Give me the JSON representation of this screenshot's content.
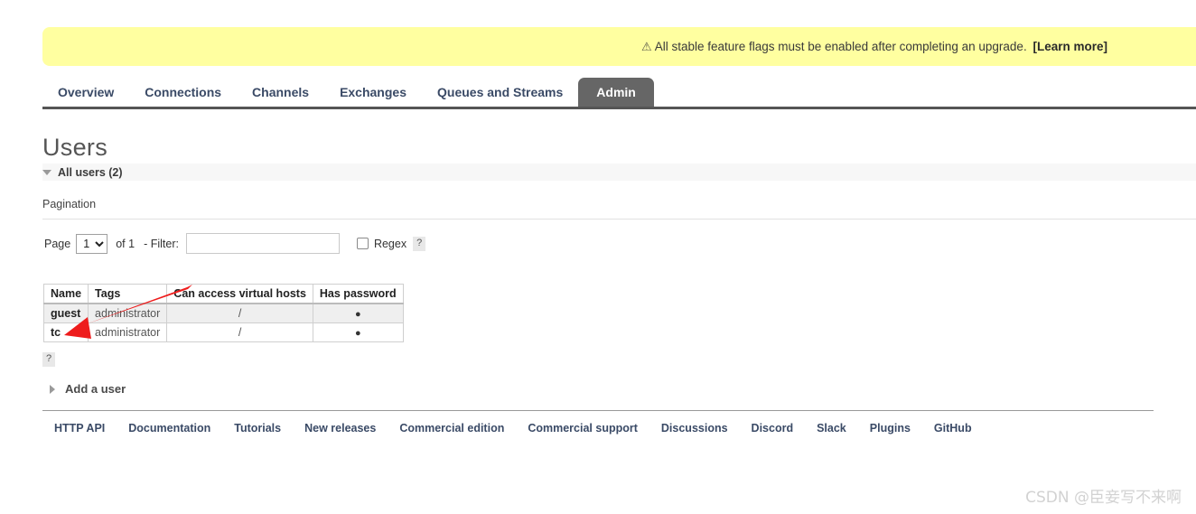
{
  "banner": {
    "icon": "warning-triangle-icon",
    "text": "All stable feature flags must be enabled after completing an upgrade.",
    "link_label": "[Learn more]",
    "background": "#ffffa0"
  },
  "nav": {
    "tabs": [
      {
        "label": "Overview",
        "active": false
      },
      {
        "label": "Connections",
        "active": false
      },
      {
        "label": "Channels",
        "active": false
      },
      {
        "label": "Exchanges",
        "active": false
      },
      {
        "label": "Queues and Streams",
        "active": false
      },
      {
        "label": "Admin",
        "active": true
      }
    ],
    "active_background": "#666666"
  },
  "page": {
    "title": "Users",
    "section_label": "All users (2)",
    "section_toggle_icon": "triangle-down-icon"
  },
  "pagination": {
    "heading": "Pagination",
    "page_label": "Page",
    "page_value": "1",
    "page_options": [
      "1"
    ],
    "of_label": "of 1",
    "filter_label": "- Filter:",
    "filter_value": "",
    "filter_placeholder": "",
    "regex_label": "Regex",
    "regex_checked": false,
    "help_label": "?"
  },
  "users_table": {
    "columns": [
      "Name",
      "Tags",
      "Can access virtual hosts",
      "Has password"
    ],
    "rows": [
      {
        "name": "guest",
        "tags": "administrator",
        "vhosts": "/",
        "has_password": "●"
      },
      {
        "name": "tc",
        "tags": "administrator",
        "vhosts": "/",
        "has_password": "●"
      }
    ],
    "help_label": "?"
  },
  "add_user": {
    "label": "Add a user",
    "toggle_icon": "triangle-right-icon"
  },
  "footer": {
    "links": [
      "HTTP API",
      "Documentation",
      "Tutorials",
      "New releases",
      "Commercial edition",
      "Commercial support",
      "Discussions",
      "Discord",
      "Slack",
      "Plugins",
      "GitHub"
    ]
  },
  "annotation": {
    "arrow_color": "#ee1c1c",
    "target": "tc"
  },
  "watermark": {
    "text": "CSDN @臣妾写不来啊"
  }
}
